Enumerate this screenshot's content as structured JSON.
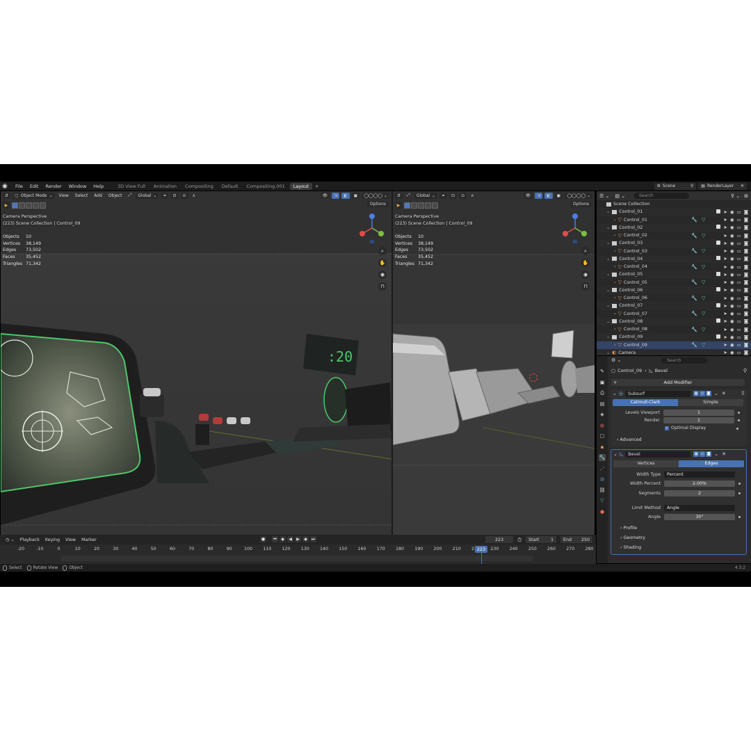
{
  "topbar": {
    "menus": [
      "File",
      "Edit",
      "Render",
      "Window",
      "Help"
    ],
    "workspaces": [
      "3D View Full",
      "Animation",
      "Compositing",
      "Default",
      "Compositing.001",
      "Layout"
    ],
    "active_workspace": "Layout",
    "scene": "Scene",
    "render_layer": "RenderLayer"
  },
  "viewport_left": {
    "mode": "Object Mode",
    "menus": [
      "View",
      "Select",
      "Add",
      "Object"
    ],
    "orientation": "Global",
    "options": "Options",
    "overlay_title": "Camera Perspective",
    "overlay_collection": "(223) Scene Collection | Control_09",
    "stats": [
      {
        "k": "Objects",
        "v": "10"
      },
      {
        "k": "Vertices",
        "v": "38,149"
      },
      {
        "k": "Edges",
        "v": "73,502"
      },
      {
        "k": "Faces",
        "v": "35,452"
      },
      {
        "k": "Triangles",
        "v": "71,342"
      }
    ]
  },
  "viewport_right": {
    "orientation": "Global",
    "options": "Options",
    "overlay_title": "Camera Perspective",
    "overlay_collection": "(223) Scene Collection | Control_09",
    "stats": [
      {
        "k": "Objects",
        "v": "10"
      },
      {
        "k": "Vertices",
        "v": "38,149"
      },
      {
        "k": "Edges",
        "v": "73,502"
      },
      {
        "k": "Faces",
        "v": "35,452"
      },
      {
        "k": "Triangles",
        "v": "71,342"
      }
    ]
  },
  "timeline": {
    "menus": [
      "Playback",
      "Keying",
      "View",
      "Marker"
    ],
    "current_frame": "223",
    "start_label": "Start",
    "start": "1",
    "end_label": "End",
    "end": "250",
    "ruler": [
      "-20",
      "-10",
      "0",
      "10",
      "20",
      "30",
      "40",
      "50",
      "60",
      "70",
      "80",
      "90",
      "100",
      "110",
      "120",
      "130",
      "140",
      "150",
      "160",
      "170",
      "180",
      "190",
      "200",
      "210",
      "220",
      "230",
      "240",
      "250",
      "260",
      "270",
      "280"
    ]
  },
  "statusbar": {
    "items": [
      "Select",
      "Rotate View",
      "Object"
    ],
    "version": "4.3.2"
  },
  "outliner": {
    "search_placeholder": "Search",
    "root": "Scene Collection",
    "rows": [
      {
        "name": "Control_01",
        "kind": "collection"
      },
      {
        "name": "Control_01",
        "kind": "mesh"
      },
      {
        "name": "Control_02",
        "kind": "collection"
      },
      {
        "name": "Control_02",
        "kind": "mesh"
      },
      {
        "name": "Control_03",
        "kind": "collection"
      },
      {
        "name": "Control_03",
        "kind": "mesh"
      },
      {
        "name": "Control_04",
        "kind": "collection"
      },
      {
        "name": "Control_04",
        "kind": "mesh"
      },
      {
        "name": "Control_05",
        "kind": "collection"
      },
      {
        "name": "Control_05",
        "kind": "mesh"
      },
      {
        "name": "Control_06",
        "kind": "collection"
      },
      {
        "name": "Control_06",
        "kind": "mesh"
      },
      {
        "name": "Control_07",
        "kind": "collection"
      },
      {
        "name": "Control_07",
        "kind": "mesh"
      },
      {
        "name": "Control_08",
        "kind": "collection"
      },
      {
        "name": "Control_08",
        "kind": "mesh"
      },
      {
        "name": "Control_09",
        "kind": "collection"
      },
      {
        "name": "Control_09",
        "kind": "mesh"
      },
      {
        "name": "Camera",
        "kind": "camera"
      }
    ]
  },
  "properties": {
    "search_placeholder": "Search",
    "object": "Control_09",
    "modifier_crumb": "Bevel",
    "add_modifier": "Add Modifier",
    "subsurf": {
      "name": "Subsurf",
      "types": [
        "Catmull-Clark",
        "Simple"
      ],
      "active_type": "Catmull-Clark",
      "levels_viewport_label": "Levels Viewport",
      "levels_viewport": "1",
      "render_label": "Render",
      "render": "1",
      "optimal_display": "Optimal Display",
      "advanced": "Advanced"
    },
    "bevel": {
      "name": "Bevel",
      "affect": [
        "Vertices",
        "Edges"
      ],
      "active_affect": "Edges",
      "width_type_label": "Width Type",
      "width_type": "Percent",
      "width_percent_label": "Width Percent",
      "width_percent": "2.00%",
      "segments_label": "Segments",
      "segments": "2",
      "limit_method_label": "Limit Method",
      "limit_method": "Angle",
      "angle_label": "Angle",
      "angle": "30°",
      "profile": "Profile",
      "geometry": "Geometry",
      "shading": "Shading"
    }
  },
  "colors": {
    "accent": "#4772b3",
    "axis_x": "#e24a4a",
    "axis_y": "#7fbf3f",
    "axis_z": "#4a7fe2",
    "mesh_icon": "#e79950",
    "data_icon": "#56c7a4"
  }
}
